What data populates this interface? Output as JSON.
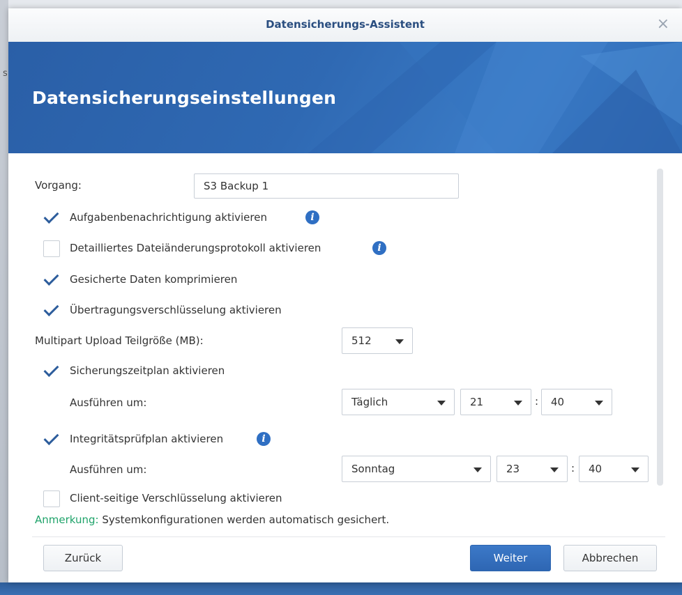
{
  "background": {
    "left_fragment": "s"
  },
  "window": {
    "title": "Datensicherungs-Assistent",
    "close_icon": "×"
  },
  "banner": {
    "heading": "Datensicherungseinstellungen",
    "color": "#2f69b3"
  },
  "form": {
    "task_label": "Vorgang:",
    "task_value": "S3 Backup 1",
    "options": [
      {
        "label": "Aufgabenbenachrichtigung aktivieren",
        "checked": true,
        "info": true
      },
      {
        "label": "Detailliertes Dateiänderungsprotokoll aktivieren",
        "checked": false,
        "info": true
      },
      {
        "label": "Gesicherte Daten komprimieren",
        "checked": true,
        "info": false
      },
      {
        "label": "Übertragungsverschlüsselung aktivieren",
        "checked": true,
        "info": false
      }
    ],
    "multipart_label": "Multipart Upload Teilgröße (MB):",
    "multipart_value": "512",
    "schedule": {
      "label": "Sicherungszeitplan aktivieren",
      "checked": true,
      "run_at_label": "Ausführen um:",
      "frequency": "Täglich",
      "hour": "21",
      "minute": "40"
    },
    "integrity": {
      "label": "Integritätsprüfplan aktivieren",
      "checked": true,
      "info": true,
      "run_at_label": "Ausführen um:",
      "day": "Sonntag",
      "hour": "23",
      "minute": "40"
    },
    "client_encryption": {
      "label": "Client-seitige Verschlüsselung aktivieren",
      "checked": false
    },
    "colon": ":"
  },
  "note": {
    "prefix": "Anmerkung:",
    "text": " Systemkonfigurationen werden automatisch gesichert.",
    "accent_color": "#1fa36a"
  },
  "buttons": {
    "back": "Zurück",
    "next": "Weiter",
    "cancel": "Abbrechen"
  },
  "info_icon_glyph": "i"
}
